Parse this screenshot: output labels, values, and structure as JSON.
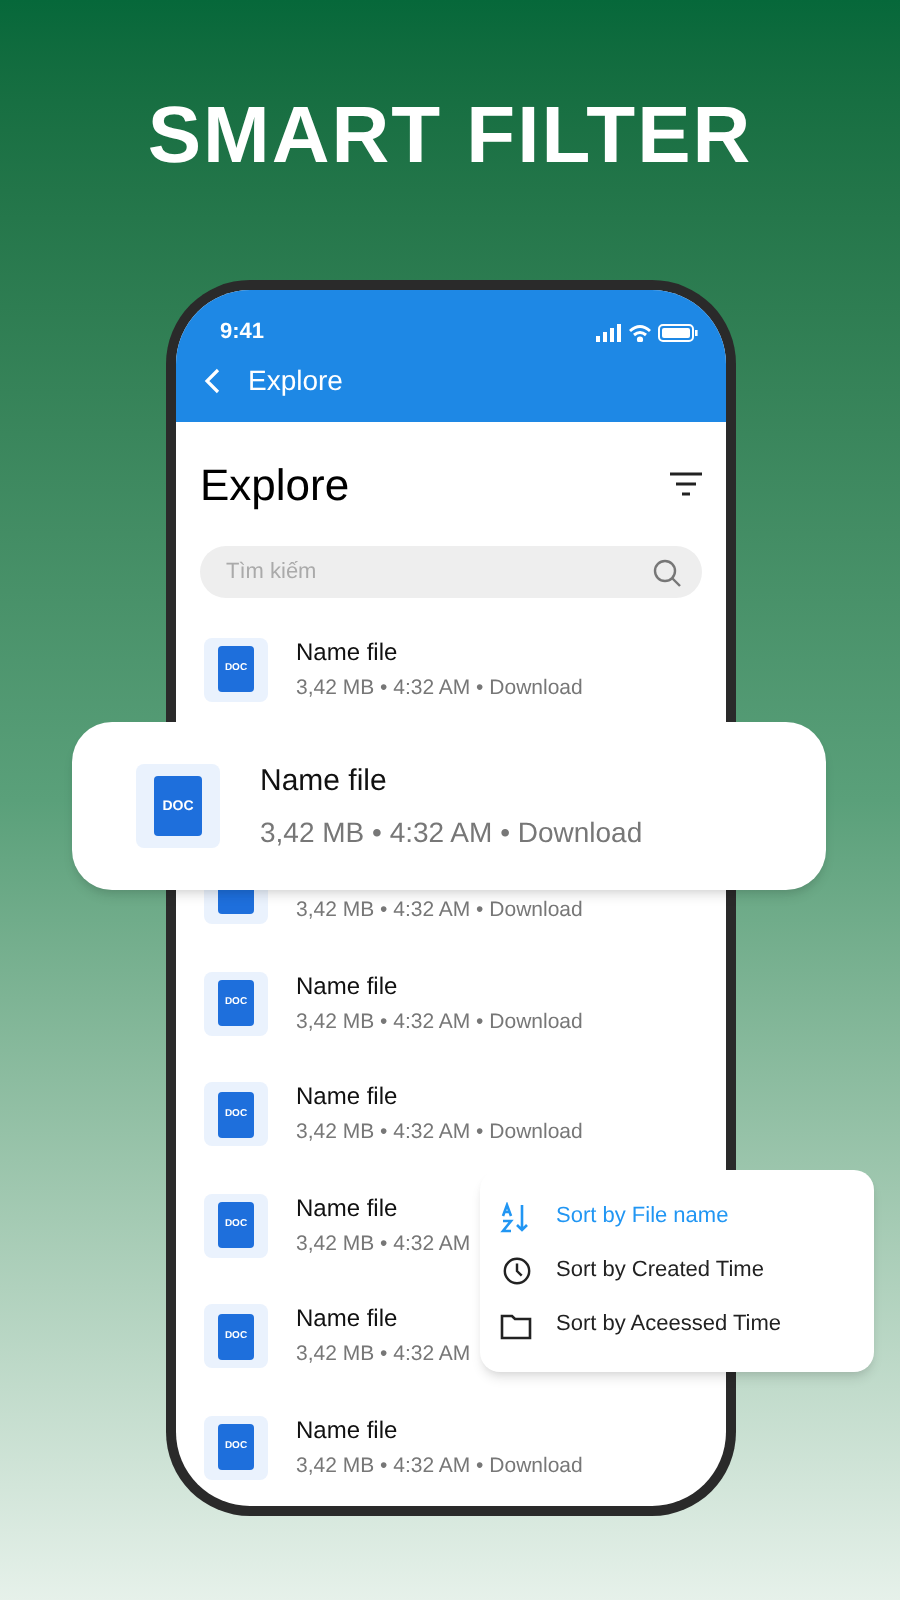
{
  "headline": "SMART FILTER",
  "status_bar": {
    "time": "9:41"
  },
  "nav_bar": {
    "title": "Explore"
  },
  "page_title": "Explore",
  "search": {
    "placeholder": "Tìm kiếm"
  },
  "files": [
    {
      "name": "Name file",
      "icon_label": "DOC",
      "meta": "3,42 MB • 4:32 AM • Download"
    },
    {
      "meta": "3,42 MB • 4:32 AM • Download"
    },
    {
      "name": "Name file",
      "icon_label": "DOC",
      "meta": "3,42 MB • 4:32 AM • Download"
    },
    {
      "name": "Name file",
      "icon_label": "DOC",
      "meta": "3,42 MB • 4:32 AM • Download"
    },
    {
      "name": "Name file",
      "icon_label": "DOC",
      "meta": "3,42 MB • 4:32 AM"
    },
    {
      "name": "Name file",
      "icon_label": "DOC",
      "meta": "3,42 MB • 4:32 AM"
    },
    {
      "name": "Name file",
      "icon_label": "DOC",
      "meta": "3,42 MB • 4:32 AM • Download"
    }
  ],
  "highlight_card": {
    "name": "Name file",
    "icon_label": "DOC",
    "meta": "3,42 MB • 4:32 AM • Download"
  },
  "sort_menu": [
    {
      "kind": "az",
      "label": "Sort by File name",
      "selected": true
    },
    {
      "kind": "clock",
      "label": "Sort by Created Time",
      "selected": false
    },
    {
      "kind": "folder",
      "label": "Sort by Aceessed Time",
      "selected": false
    }
  ]
}
